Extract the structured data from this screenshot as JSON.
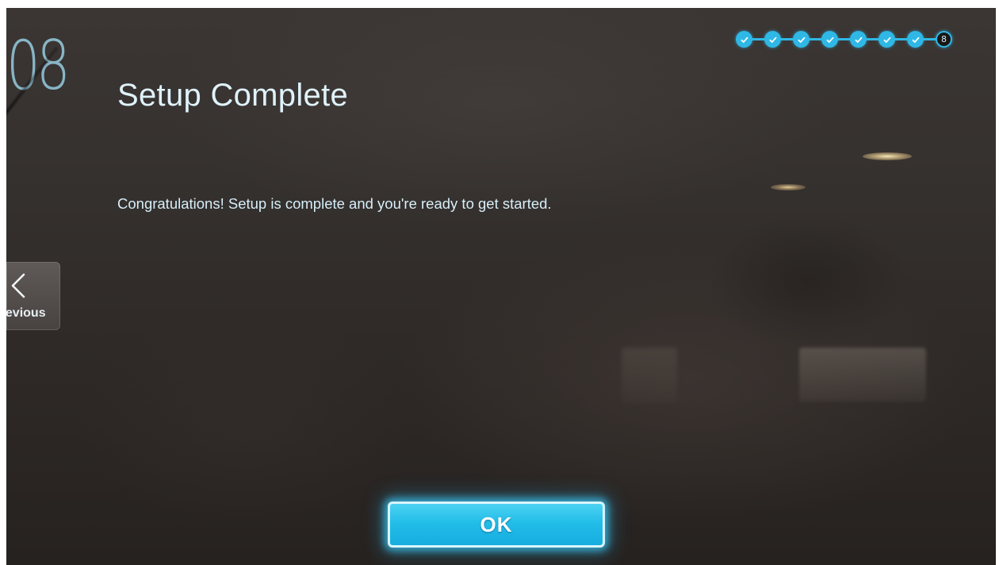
{
  "step": {
    "number": "08",
    "title": "Setup Complete",
    "current_step_label": "8",
    "completed_steps": 7,
    "total_steps": 8
  },
  "content": {
    "message": "Congratulations! Setup is complete and you're ready to get started."
  },
  "navigation": {
    "previous_label": "Previous",
    "previous_icon": "chevron-left-icon"
  },
  "actions": {
    "ok_label": "OK"
  },
  "colors": {
    "accent": "#2fb8e6",
    "button": "#23bde8",
    "text": "#dff2fa",
    "background": "#35312f"
  }
}
